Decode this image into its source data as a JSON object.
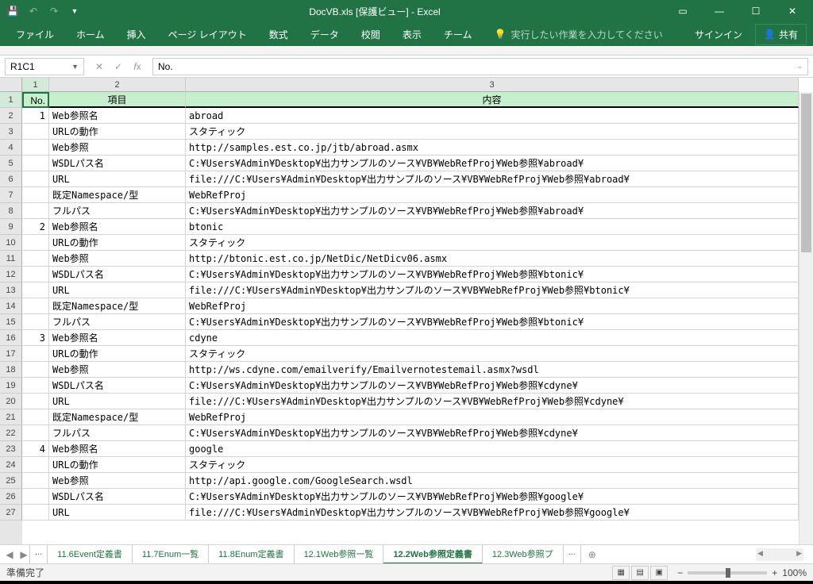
{
  "title": "DocVB.xls  [保護ビュー] - Excel",
  "ribbon": {
    "tabs": [
      "ファイル",
      "ホーム",
      "挿入",
      "ページ レイアウト",
      "数式",
      "データ",
      "校閲",
      "表示",
      "チーム"
    ],
    "tell": "実行したい作業を入力してください",
    "signin": "サインイン",
    "share": "共有"
  },
  "nameBox": "R1C1",
  "formula": "No.",
  "colHeaders": [
    "1",
    "2",
    "3"
  ],
  "headers": {
    "c1": "No.",
    "c2": "項目",
    "c3": "内容"
  },
  "rows": [
    {
      "no": "1",
      "item": "Web参照名",
      "content": "abroad"
    },
    {
      "no": "",
      "item": "URLの動作",
      "content": "スタティック"
    },
    {
      "no": "",
      "item": "Web参照",
      "content": "http://samples.est.co.jp/jtb/abroad.asmx"
    },
    {
      "no": "",
      "item": "WSDLパス名",
      "content": "C:¥Users¥Admin¥Desktop¥出力サンプルのソース¥VB¥WebRefProj¥Web参照¥abroad¥"
    },
    {
      "no": "",
      "item": "URL",
      "content": "file:///C:¥Users¥Admin¥Desktop¥出力サンプルのソース¥VB¥WebRefProj¥Web参照¥abroad¥"
    },
    {
      "no": "",
      "item": "既定Namespace/型",
      "content": "WebRefProj"
    },
    {
      "no": "",
      "item": "フルパス",
      "content": "C:¥Users¥Admin¥Desktop¥出力サンプルのソース¥VB¥WebRefProj¥Web参照¥abroad¥"
    },
    {
      "no": "2",
      "item": "Web参照名",
      "content": "btonic"
    },
    {
      "no": "",
      "item": "URLの動作",
      "content": "スタティック"
    },
    {
      "no": "",
      "item": "Web参照",
      "content": "http://btonic.est.co.jp/NetDic/NetDicv06.asmx"
    },
    {
      "no": "",
      "item": "WSDLパス名",
      "content": "C:¥Users¥Admin¥Desktop¥出力サンプルのソース¥VB¥WebRefProj¥Web参照¥btonic¥"
    },
    {
      "no": "",
      "item": "URL",
      "content": "file:///C:¥Users¥Admin¥Desktop¥出力サンプルのソース¥VB¥WebRefProj¥Web参照¥btonic¥"
    },
    {
      "no": "",
      "item": "既定Namespace/型",
      "content": "WebRefProj"
    },
    {
      "no": "",
      "item": "フルパス",
      "content": "C:¥Users¥Admin¥Desktop¥出力サンプルのソース¥VB¥WebRefProj¥Web参照¥btonic¥"
    },
    {
      "no": "3",
      "item": "Web参照名",
      "content": "cdyne"
    },
    {
      "no": "",
      "item": "URLの動作",
      "content": "スタティック"
    },
    {
      "no": "",
      "item": "Web参照",
      "content": "http://ws.cdyne.com/emailverify/Emailvernotestemail.asmx?wsdl"
    },
    {
      "no": "",
      "item": "WSDLパス名",
      "content": "C:¥Users¥Admin¥Desktop¥出力サンプルのソース¥VB¥WebRefProj¥Web参照¥cdyne¥"
    },
    {
      "no": "",
      "item": "URL",
      "content": "file:///C:¥Users¥Admin¥Desktop¥出力サンプルのソース¥VB¥WebRefProj¥Web参照¥cdyne¥"
    },
    {
      "no": "",
      "item": "既定Namespace/型",
      "content": "WebRefProj"
    },
    {
      "no": "",
      "item": "フルパス",
      "content": "C:¥Users¥Admin¥Desktop¥出力サンプルのソース¥VB¥WebRefProj¥Web参照¥cdyne¥"
    },
    {
      "no": "4",
      "item": "Web参照名",
      "content": "google"
    },
    {
      "no": "",
      "item": "URLの動作",
      "content": "スタティック"
    },
    {
      "no": "",
      "item": "Web参照",
      "content": "http://api.google.com/GoogleSearch.wsdl"
    },
    {
      "no": "",
      "item": "WSDLパス名",
      "content": "C:¥Users¥Admin¥Desktop¥出力サンプルのソース¥VB¥WebRefProj¥Web参照¥google¥"
    },
    {
      "no": "",
      "item": "URL",
      "content": "file:///C:¥Users¥Admin¥Desktop¥出力サンプルのソース¥VB¥WebRefProj¥Web参照¥google¥"
    }
  ],
  "sheetTabs": [
    "...",
    "11.6Event定義書",
    "11.7Enum一覧",
    "11.8Enum定義書",
    "12.1Web参照一覧",
    "12.2Web参照定義書",
    "12.3Web参照プ",
    "..."
  ],
  "activeTab": "12.2Web参照定義書",
  "status": "準備完了",
  "zoom": "100%",
  "colWidths": {
    "c1": 34,
    "c2": 172,
    "c3": 756
  }
}
